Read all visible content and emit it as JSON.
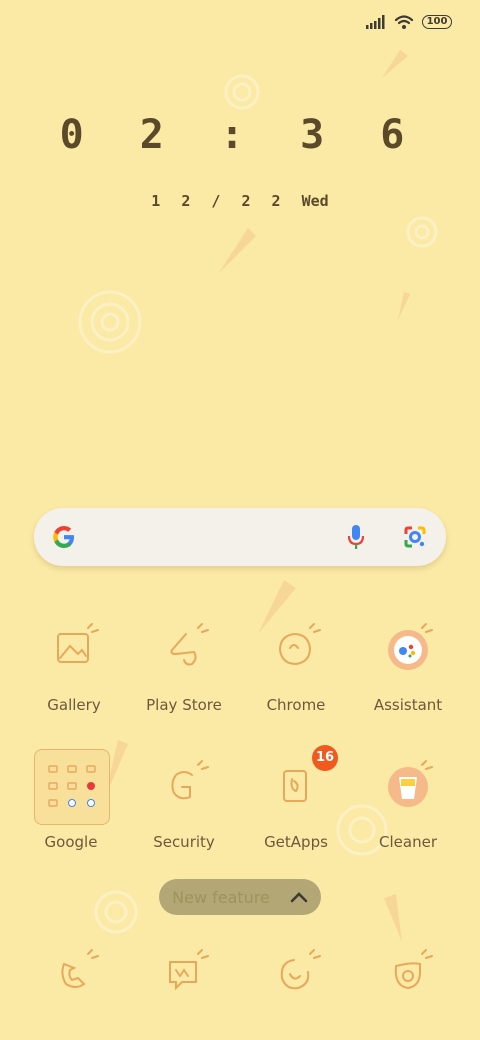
{
  "status": {
    "battery": "100"
  },
  "clock": {
    "time": "0 2 : 3 6",
    "date": "1 2 / 2 2",
    "weekday": "Wed"
  },
  "apps_row1": [
    {
      "label": "Gallery"
    },
    {
      "label": "Play Store"
    },
    {
      "label": "Chrome"
    },
    {
      "label": "Assistant"
    }
  ],
  "apps_row2": [
    {
      "label": "Google"
    },
    {
      "label": "Security"
    },
    {
      "label": "GetApps",
      "badge": "16"
    },
    {
      "label": "Cleaner"
    }
  ],
  "new_feature": {
    "label": "New feature"
  },
  "colors": {
    "background": "#fbe9a6",
    "icon_stroke": "#e8a85c",
    "badge": "#f05a1e"
  }
}
